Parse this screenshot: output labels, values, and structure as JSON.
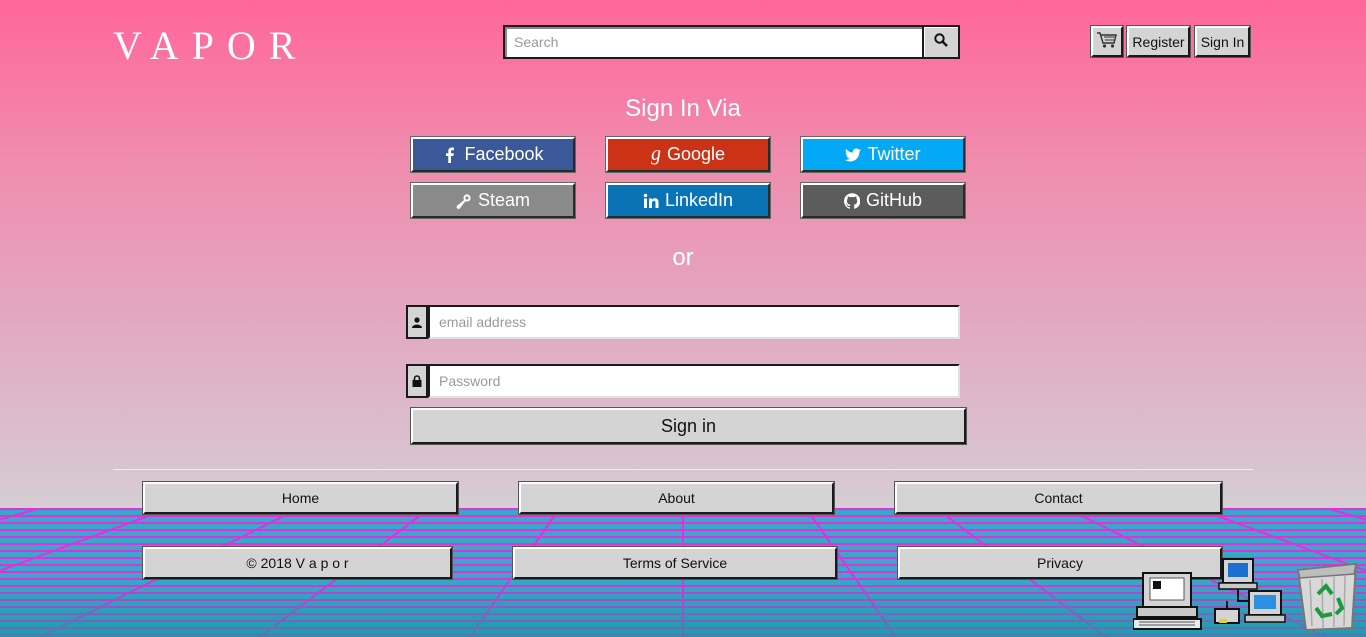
{
  "header": {
    "logo": "VAPOR",
    "search": {
      "placeholder": "Search",
      "value": ""
    },
    "register_label": "Register",
    "signin_label": "Sign In"
  },
  "icons": {
    "search": "search-icon",
    "cart": "cart-icon",
    "user": "user-icon",
    "lock": "lock-icon"
  },
  "signin": {
    "heading": "Sign In Via",
    "providers": [
      {
        "label": "Facebook",
        "color": "#3b5998",
        "icon": "facebook-icon"
      },
      {
        "label": "Google",
        "color": "#cc3316",
        "icon": "google-icon"
      },
      {
        "label": "Twitter",
        "color": "#03a9f4",
        "icon": "twitter-icon"
      },
      {
        "label": "Steam",
        "color": "#8a8a8a",
        "icon": "steam-icon"
      },
      {
        "label": "LinkedIn",
        "color": "#0a73b5",
        "icon": "linkedin-icon"
      },
      {
        "label": "GitHub",
        "color": "#5c5c5c",
        "icon": "github-icon"
      }
    ],
    "or_label": "or",
    "email": {
      "placeholder": "email address",
      "value": ""
    },
    "password": {
      "placeholder": "Password",
      "value": ""
    },
    "submit_label": "Sign in"
  },
  "footer": {
    "home": "Home",
    "about": "About",
    "contact": "Contact",
    "copyright": "© 2018 V a p o r",
    "terms": "Terms of Service",
    "privacy": "Privacy"
  },
  "desktop_icons": [
    "computer-icon",
    "network-icon",
    "recycle-bin-icon"
  ],
  "colors": {
    "sky_top": "#ff6699",
    "grid_line": "#e030e0",
    "grid_fill": "#3aa7c8",
    "button_face": "#d4d4d4"
  }
}
